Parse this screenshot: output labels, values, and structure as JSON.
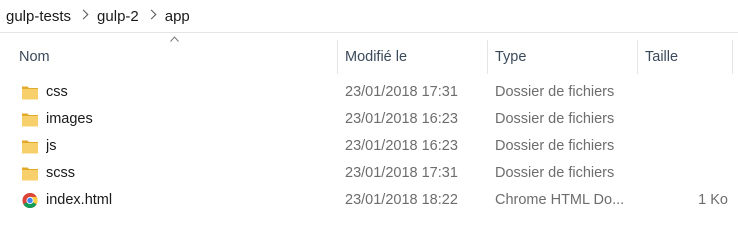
{
  "breadcrumb": {
    "items": [
      "gulp-tests",
      "gulp-2",
      "app"
    ]
  },
  "columns": {
    "name": "Nom",
    "modified": "Modifié le",
    "type": "Type",
    "size": "Taille"
  },
  "files": [
    {
      "name": "css",
      "modified": "23/01/2018 17:31",
      "type": "Dossier de fichiers",
      "size": "",
      "icon": "folder-icon"
    },
    {
      "name": "images",
      "modified": "23/01/2018 16:23",
      "type": "Dossier de fichiers",
      "size": "",
      "icon": "folder-icon"
    },
    {
      "name": "js",
      "modified": "23/01/2018 16:23",
      "type": "Dossier de fichiers",
      "size": "",
      "icon": "folder-icon"
    },
    {
      "name": "scss",
      "modified": "23/01/2018 17:31",
      "type": "Dossier de fichiers",
      "size": "",
      "icon": "folder-icon"
    },
    {
      "name": "index.html",
      "modified": "23/01/2018 18:22",
      "type": "Chrome HTML Do...",
      "size": "1 Ko",
      "icon": "chrome-icon"
    }
  ],
  "colors": {
    "folder_yellow": "#f7d06b",
    "folder_dark": "#e2aa2a",
    "header_text": "#3b4a5a",
    "detail_text": "#6d6d6d"
  }
}
